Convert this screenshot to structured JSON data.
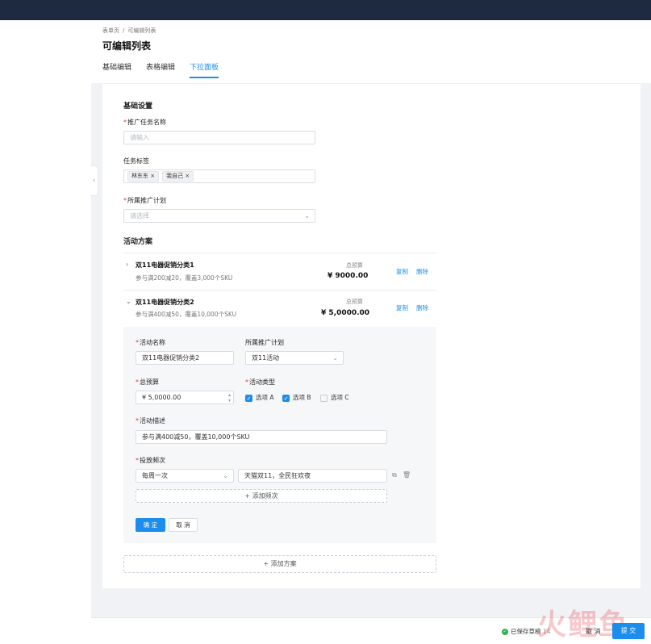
{
  "breadcrumb": {
    "root": "表单页",
    "sep": "/",
    "current": "可编辑列表"
  },
  "page": {
    "title": "可编辑列表"
  },
  "tabs": [
    {
      "label": "基础编辑"
    },
    {
      "label": "表格编辑"
    },
    {
      "label": "下拉面板"
    }
  ],
  "basic": {
    "section_title": "基础设置",
    "task_name": {
      "label": "推广任务名称",
      "placeholder": "请输入"
    },
    "tags": {
      "label": "任务标签",
      "items": [
        "林东东",
        "我自己"
      ]
    },
    "plan_select": {
      "label": "所属推广计划",
      "placeholder": "请选择"
    }
  },
  "activity": {
    "section_title": "活动方案",
    "budget_label": "总预算",
    "copy_label": "复制",
    "delete_label": "删除",
    "plans": [
      {
        "name": "双11电器促销分类1",
        "desc": "参与满200减20，覆盖3,000个SKU",
        "budget": "¥ 9000.00"
      },
      {
        "name": "双11电器促销分类2",
        "desc": "参与满400减50，覆盖10,000个SKU",
        "budget": "¥ 5,0000.00"
      }
    ],
    "form": {
      "name_label": "活动名称",
      "name_value": "双11电器促销分类2",
      "plan_label": "所属推广计划",
      "plan_value": "双11活动",
      "budget_label": "总预算",
      "budget_value": "¥ 5,0000.00",
      "type_label": "活动类型",
      "type_options": [
        {
          "label": "选项 A",
          "checked": true
        },
        {
          "label": "选项 B",
          "checked": true
        },
        {
          "label": "选项 C",
          "checked": false
        }
      ],
      "desc_label": "活动描述",
      "desc_value": "参与满400减50，覆盖10,000个SKU",
      "freq_label": "投放频次",
      "freq_value": "每周一次",
      "freq_note": "天猫双11，全民狂欢夜",
      "add_freq_label": "添加频次",
      "confirm_label": "确 定",
      "cancel_label": "取 消"
    },
    "add_plan_label": "添加方案"
  },
  "footer": {
    "saved_text": "已保存草稿",
    "saved_time": "14",
    "cancel_label": "取 消",
    "submit_label": "提 交"
  },
  "watermark": "火鲤鱼",
  "colors": {
    "primary": "#1c8ded",
    "topbar": "#1e2a3f",
    "required": "#e23c39",
    "success": "#2bb24c"
  }
}
